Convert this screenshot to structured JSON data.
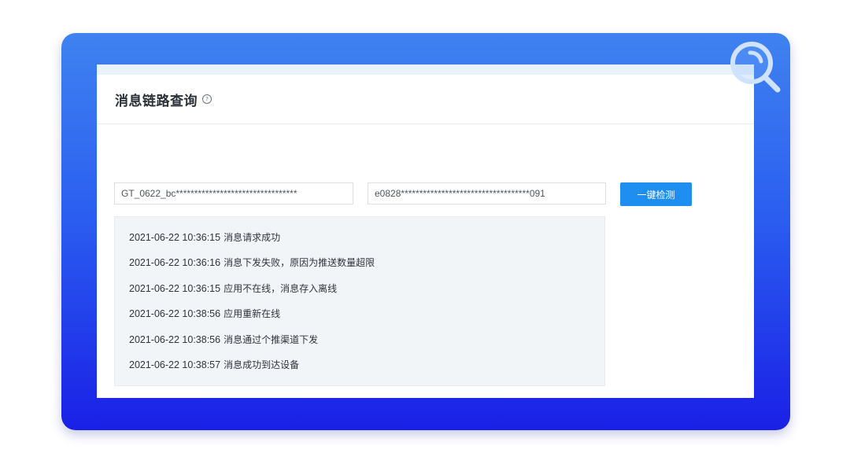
{
  "panel": {
    "title": "消息链路查询",
    "help_icon_glyph": "?"
  },
  "query": {
    "client_id_value": "GT_0622_bc*********************************",
    "device_id_value": "e0828***********************************091",
    "detect_button_label": "一键检测"
  },
  "log": [
    {
      "time": "2021-06-22 10:36:15",
      "message": "消息请求成功"
    },
    {
      "time": "2021-06-22 10:36:16",
      "message": "消息下发失败，原因为推送数量超限"
    },
    {
      "time": "2021-06-22 10:36:15",
      "message": "应用不在线，消息存入离线"
    },
    {
      "time": "2021-06-22 10:38:56",
      "message": "应用重新在线"
    },
    {
      "time": "2021-06-22 10:38:56",
      "message": "消息通过个推渠道下发"
    },
    {
      "time": "2021-06-22 10:38:57",
      "message": "消息成功到达设备"
    }
  ],
  "decor": {
    "search_icon": "search-icon",
    "frame_gradient": [
      "#3f82f0",
      "#1a20e6"
    ],
    "accent_button_color": "#1e8ef0"
  }
}
